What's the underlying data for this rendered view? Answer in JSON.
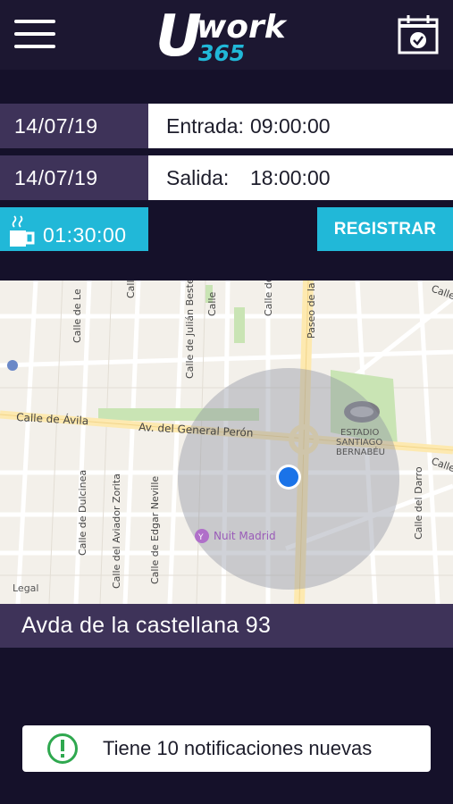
{
  "header": {
    "logo_main": "work",
    "logo_letter": "U",
    "logo_sub": "365"
  },
  "entries": [
    {
      "date": "14/07/19",
      "label": "Entrada:",
      "time": "09:00:00"
    },
    {
      "date": "14/07/19",
      "label": "Salida:",
      "time": "18:00:00"
    }
  ],
  "break": {
    "time": "01:30:00"
  },
  "register_label": "REGISTRAR",
  "map": {
    "labels": {
      "calle_avila": "Calle de Ávila",
      "general_peron": "Av. del General Perón",
      "estadio_1": "ESTADIO",
      "estadio_2": "SANTIAGO",
      "estadio_3": "BERNABÉU",
      "nuit": "Nuit Madrid",
      "dulcinea": "Calle de Dulcinea",
      "aviador": "Calle del Aviador Zorita",
      "edgar": "Calle de Edgar Neville",
      "julian": "Calle de Julián Besteiro",
      "paseo": "Paseo de la",
      "darro": "Calle del Darro",
      "legal": "Legal",
      "calle_top1": "Calle de Le",
      "calle_top2": "Calle",
      "calle_right": "Calle",
      "calle_c1": "Calle",
      "calle_c2": "Calle de",
      "calle_top_right": "Calle"
    }
  },
  "address": "Avda de la castellana 93",
  "notification": {
    "text": "Tiene 10 notificaciones nuevas"
  },
  "colors": {
    "accent": "#21b8d8",
    "purple": "#3e3359",
    "background": "#15112a"
  }
}
